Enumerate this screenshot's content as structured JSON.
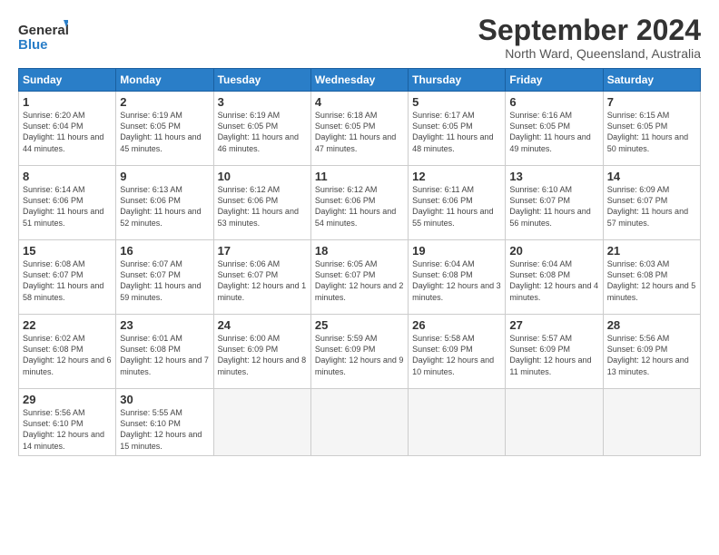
{
  "logo": {
    "line1": "General",
    "line2": "Blue"
  },
  "title": "September 2024",
  "subtitle": "North Ward, Queensland, Australia",
  "weekdays": [
    "Sunday",
    "Monday",
    "Tuesday",
    "Wednesday",
    "Thursday",
    "Friday",
    "Saturday"
  ],
  "weeks": [
    [
      {
        "day": "1",
        "sunrise": "6:20 AM",
        "sunset": "6:04 PM",
        "daylight": "11 hours and 44 minutes."
      },
      {
        "day": "2",
        "sunrise": "6:19 AM",
        "sunset": "6:05 PM",
        "daylight": "11 hours and 45 minutes."
      },
      {
        "day": "3",
        "sunrise": "6:19 AM",
        "sunset": "6:05 PM",
        "daylight": "11 hours and 46 minutes."
      },
      {
        "day": "4",
        "sunrise": "6:18 AM",
        "sunset": "6:05 PM",
        "daylight": "11 hours and 47 minutes."
      },
      {
        "day": "5",
        "sunrise": "6:17 AM",
        "sunset": "6:05 PM",
        "daylight": "11 hours and 48 minutes."
      },
      {
        "day": "6",
        "sunrise": "6:16 AM",
        "sunset": "6:05 PM",
        "daylight": "11 hours and 49 minutes."
      },
      {
        "day": "7",
        "sunrise": "6:15 AM",
        "sunset": "6:05 PM",
        "daylight": "11 hours and 50 minutes."
      }
    ],
    [
      {
        "day": "8",
        "sunrise": "6:14 AM",
        "sunset": "6:06 PM",
        "daylight": "11 hours and 51 minutes."
      },
      {
        "day": "9",
        "sunrise": "6:13 AM",
        "sunset": "6:06 PM",
        "daylight": "11 hours and 52 minutes."
      },
      {
        "day": "10",
        "sunrise": "6:12 AM",
        "sunset": "6:06 PM",
        "daylight": "11 hours and 53 minutes."
      },
      {
        "day": "11",
        "sunrise": "6:12 AM",
        "sunset": "6:06 PM",
        "daylight": "11 hours and 54 minutes."
      },
      {
        "day": "12",
        "sunrise": "6:11 AM",
        "sunset": "6:06 PM",
        "daylight": "11 hours and 55 minutes."
      },
      {
        "day": "13",
        "sunrise": "6:10 AM",
        "sunset": "6:07 PM",
        "daylight": "11 hours and 56 minutes."
      },
      {
        "day": "14",
        "sunrise": "6:09 AM",
        "sunset": "6:07 PM",
        "daylight": "11 hours and 57 minutes."
      }
    ],
    [
      {
        "day": "15",
        "sunrise": "6:08 AM",
        "sunset": "6:07 PM",
        "daylight": "11 hours and 58 minutes."
      },
      {
        "day": "16",
        "sunrise": "6:07 AM",
        "sunset": "6:07 PM",
        "daylight": "11 hours and 59 minutes."
      },
      {
        "day": "17",
        "sunrise": "6:06 AM",
        "sunset": "6:07 PM",
        "daylight": "12 hours and 1 minute."
      },
      {
        "day": "18",
        "sunrise": "6:05 AM",
        "sunset": "6:07 PM",
        "daylight": "12 hours and 2 minutes."
      },
      {
        "day": "19",
        "sunrise": "6:04 AM",
        "sunset": "6:08 PM",
        "daylight": "12 hours and 3 minutes."
      },
      {
        "day": "20",
        "sunrise": "6:04 AM",
        "sunset": "6:08 PM",
        "daylight": "12 hours and 4 minutes."
      },
      {
        "day": "21",
        "sunrise": "6:03 AM",
        "sunset": "6:08 PM",
        "daylight": "12 hours and 5 minutes."
      }
    ],
    [
      {
        "day": "22",
        "sunrise": "6:02 AM",
        "sunset": "6:08 PM",
        "daylight": "12 hours and 6 minutes."
      },
      {
        "day": "23",
        "sunrise": "6:01 AM",
        "sunset": "6:08 PM",
        "daylight": "12 hours and 7 minutes."
      },
      {
        "day": "24",
        "sunrise": "6:00 AM",
        "sunset": "6:09 PM",
        "daylight": "12 hours and 8 minutes."
      },
      {
        "day": "25",
        "sunrise": "5:59 AM",
        "sunset": "6:09 PM",
        "daylight": "12 hours and 9 minutes."
      },
      {
        "day": "26",
        "sunrise": "5:58 AM",
        "sunset": "6:09 PM",
        "daylight": "12 hours and 10 minutes."
      },
      {
        "day": "27",
        "sunrise": "5:57 AM",
        "sunset": "6:09 PM",
        "daylight": "12 hours and 11 minutes."
      },
      {
        "day": "28",
        "sunrise": "5:56 AM",
        "sunset": "6:09 PM",
        "daylight": "12 hours and 13 minutes."
      }
    ],
    [
      {
        "day": "29",
        "sunrise": "5:56 AM",
        "sunset": "6:10 PM",
        "daylight": "12 hours and 14 minutes."
      },
      {
        "day": "30",
        "sunrise": "5:55 AM",
        "sunset": "6:10 PM",
        "daylight": "12 hours and 15 minutes."
      },
      null,
      null,
      null,
      null,
      null
    ]
  ]
}
